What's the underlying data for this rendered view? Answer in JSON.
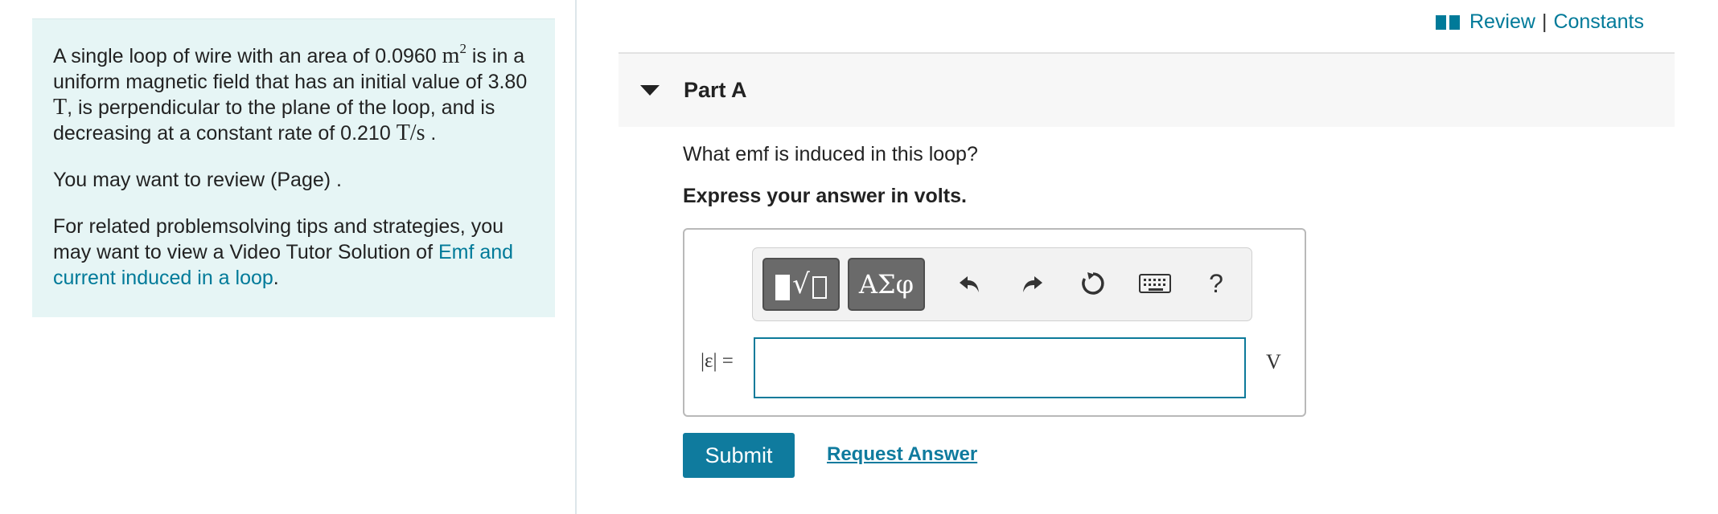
{
  "problem": {
    "p1_text_a": "A single loop of wire with an area of 0.0960 ",
    "p1_area_unit": "m",
    "p1_area_exp": "2",
    "p1_text_b": " is in a uniform magnetic field that has an initial value of 3.80 ",
    "p1_field_unit": "T",
    "p1_text_c": ", is perpendicular to the plane of the loop, and is decreasing at a constant rate of 0.210 ",
    "p1_rate_unit": "T/s",
    "p1_text_d": " .",
    "p2_text": "You may want to review (Page) .",
    "p3_text": "For related problemsolving tips and strategies, you may want to view a Video Tutor Solution of ",
    "p3_link": "Emf and current induced in a loop",
    "p3_end": "."
  },
  "top_links": {
    "icon": "book-icon",
    "review": "Review",
    "separator": "|",
    "constants": "Constants"
  },
  "part": {
    "title": "Part A",
    "caret_icon": "caret-down-icon",
    "question": "What emf is induced in this loop?",
    "instruction": "Express your answer in volts."
  },
  "toolbar": {
    "templates_icon": "templates-icon",
    "greek_label": "ΑΣφ",
    "undo_icon": "undo-icon",
    "redo_icon": "redo-icon",
    "reset_icon": "reset-icon",
    "keyboard_icon": "keyboard-icon",
    "help_label": "?"
  },
  "answer": {
    "label": "|ε| =",
    "value": "",
    "unit": "V"
  },
  "buttons": {
    "submit": "Submit",
    "request_answer": "Request Answer"
  },
  "colors": {
    "accent": "#0f7b9e",
    "panel_bg": "#e6f5f5",
    "link": "#007a99"
  }
}
